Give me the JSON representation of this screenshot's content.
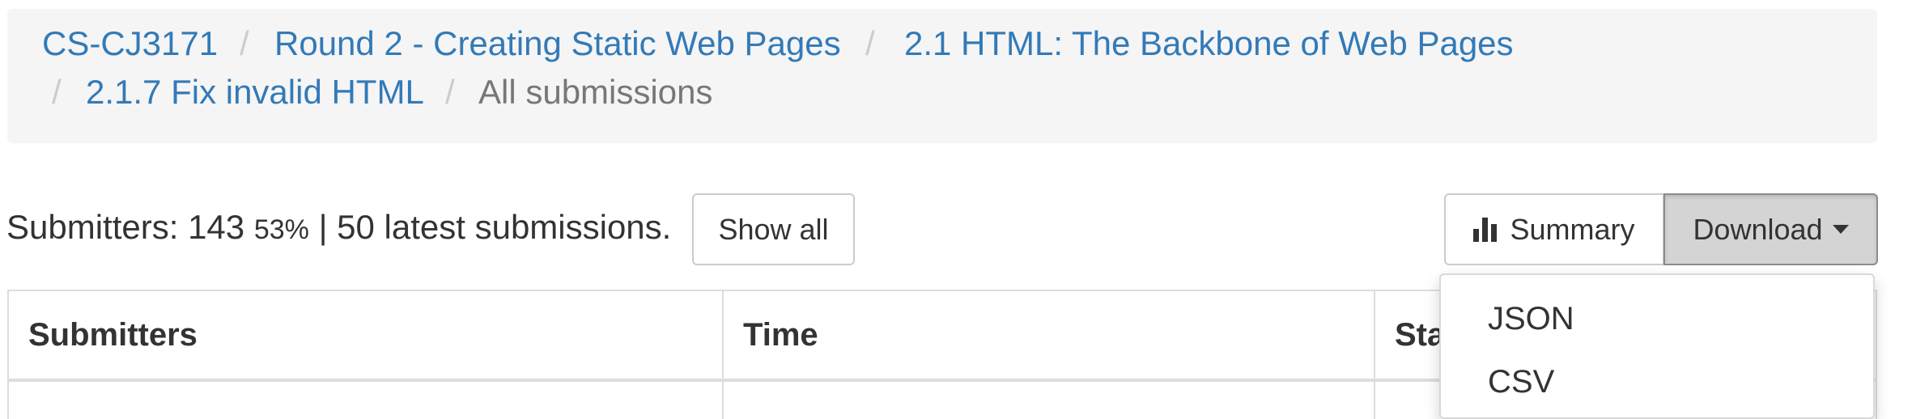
{
  "breadcrumb": {
    "items": [
      {
        "label": "CS-CJ3171"
      },
      {
        "label": "Round 2 - Creating Static Web Pages"
      },
      {
        "label": "2.1 HTML: The Backbone of Web Pages"
      },
      {
        "label": "2.1.7 Fix invalid HTML"
      },
      {
        "label": "All submissions"
      }
    ],
    "separator": "/"
  },
  "status": {
    "prefix": "Submitters: 143",
    "percent": "53%",
    "suffix": "| 50 latest submissions."
  },
  "buttons": {
    "show_all": "Show all",
    "summary": "Summary",
    "download": "Download"
  },
  "table": {
    "headers": [
      "Submitters",
      "Time",
      "Sta"
    ]
  },
  "download_menu": {
    "items": [
      "JSON",
      "CSV"
    ]
  },
  "colors": {
    "link": "#337ab7",
    "breadcrumb_bg": "#f5f5f5",
    "active_crumb": "#777777"
  }
}
